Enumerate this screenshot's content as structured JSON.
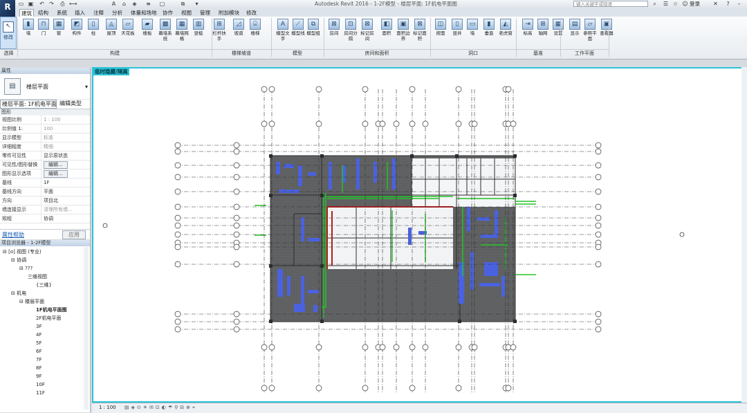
{
  "app": {
    "title": "Autodesk Revit 2016 -   1-2F模型 - 楼层平面: 1F机电平面图",
    "logo_letter": "R",
    "search_placeholder": "键入关键字或短语",
    "user_label": "登录"
  },
  "tabs": [
    "建筑",
    "结构",
    "系统",
    "插入",
    "注释",
    "分析",
    "体量和场地",
    "协作",
    "视图",
    "管理",
    "附加模块",
    "修改"
  ],
  "active_tab": "建筑",
  "ribbon": {
    "modify_label": "修改",
    "select_label": "选择",
    "buttons": [
      {
        "label": "墙",
        "icon": "wall-icon"
      },
      {
        "label": "门",
        "icon": "door-icon"
      },
      {
        "label": "窗",
        "icon": "window-icon"
      },
      {
        "label": "构件",
        "icon": "component-icon"
      },
      {
        "label": "柱",
        "icon": "column-icon"
      },
      {
        "label": "屋顶",
        "icon": "roof-icon"
      },
      {
        "label": "天花板",
        "icon": "ceiling-icon"
      },
      {
        "label": "楼板",
        "icon": "floor-icon"
      },
      {
        "label": "幕墙系统",
        "icon": "curtain-system-icon"
      },
      {
        "label": "幕墙网格",
        "icon": "curtain-grid-icon"
      },
      {
        "label": "竖梃",
        "icon": "mullion-icon"
      },
      {
        "label": "栏杆扶手",
        "icon": "railing-icon"
      },
      {
        "label": "坡道",
        "icon": "ramp-icon"
      },
      {
        "label": "楼梯",
        "icon": "stair-icon"
      },
      {
        "label": "模型文字",
        "icon": "model-text-icon"
      },
      {
        "label": "模型线",
        "icon": "model-line-icon"
      },
      {
        "label": "模型组",
        "icon": "model-group-icon"
      },
      {
        "label": "房间",
        "icon": "room-icon"
      },
      {
        "label": "房间分隔",
        "icon": "room-separator-icon"
      },
      {
        "label": "标记房间",
        "icon": "tag-room-icon"
      },
      {
        "label": "面积",
        "icon": "area-icon"
      },
      {
        "label": "面积边界",
        "icon": "area-boundary-icon"
      },
      {
        "label": "标记面积",
        "icon": "tag-area-icon"
      },
      {
        "label": "按面",
        "icon": "by-face-icon"
      },
      {
        "label": "竖井",
        "icon": "shaft-icon"
      },
      {
        "label": "墙",
        "icon": "wall-opening-icon"
      },
      {
        "label": "垂直",
        "icon": "vertical-icon"
      },
      {
        "label": "老虎窗",
        "icon": "dormer-icon"
      },
      {
        "label": "标高",
        "icon": "level-icon"
      },
      {
        "label": "轴网",
        "icon": "grid-icon"
      },
      {
        "label": "设置",
        "icon": "set-icon"
      },
      {
        "label": "显示",
        "icon": "show-icon"
      },
      {
        "label": "参照平面",
        "icon": "ref-plane-icon"
      },
      {
        "label": "查看器",
        "icon": "viewer-icon"
      }
    ],
    "groups": [
      "选择",
      "构建",
      "楼梯坡道",
      "模型",
      "房间和面积",
      "洞口",
      "基准",
      "工作平面"
    ]
  },
  "properties": {
    "header": "属性",
    "type_name": "楼层平面",
    "view_selector": "楼层平面: 1F机电平面图",
    "edit_type": "编辑类型",
    "section_graphics": "图形",
    "rows": [
      {
        "k": "视图比例",
        "v": "1 : 100",
        "dim": true
      },
      {
        "k": "比例值 1:",
        "v": "100",
        "dim": true
      },
      {
        "k": "显示模型",
        "v": "标准",
        "dim": true
      },
      {
        "k": "详细程度",
        "v": "精细",
        "dim": true
      },
      {
        "k": "零件可见性",
        "v": "显示原状态",
        "dim": false
      },
      {
        "k": "可见性/图形替换",
        "v": "编辑...",
        "dim": false,
        "btn": true
      },
      {
        "k": "图形显示选项",
        "v": "编辑...",
        "dim": false,
        "btn": true
      },
      {
        "k": "基线",
        "v": "1F",
        "dim": false
      },
      {
        "k": "基线方向",
        "v": "平面",
        "dim": false
      },
      {
        "k": "方向",
        "v": "项目北",
        "dim": false
      },
      {
        "k": "墙连接显示",
        "v": "清理所有墙...",
        "dim": true
      },
      {
        "k": "规程",
        "v": "协调",
        "dim": false
      }
    ],
    "help_link": "属性帮助",
    "apply": "应用"
  },
  "browser": {
    "header": "项目浏览器 - 1-2F模型",
    "nodes": [
      {
        "t": "[o] 视图 (专业)",
        "lvl": 0
      },
      {
        "t": "协调",
        "lvl": 1
      },
      {
        "t": "???",
        "lvl": 2
      },
      {
        "t": "三维视图",
        "lvl": 3
      },
      {
        "t": "{三维}",
        "lvl": 4
      },
      {
        "t": "机电",
        "lvl": 1
      },
      {
        "t": "楼层平面",
        "lvl": 2
      },
      {
        "t": "1F机电平面图",
        "lvl": 4,
        "bold": true
      },
      {
        "t": "2F机电平面",
        "lvl": 4
      },
      {
        "t": "3F",
        "lvl": 4
      },
      {
        "t": "4F",
        "lvl": 4
      },
      {
        "t": "5F",
        "lvl": 4
      },
      {
        "t": "6F",
        "lvl": 4
      },
      {
        "t": "7F",
        "lvl": 4
      },
      {
        "t": "8F",
        "lvl": 4
      },
      {
        "t": "9F",
        "lvl": 4
      },
      {
        "t": "10F",
        "lvl": 4
      },
      {
        "t": "11F",
        "lvl": 4
      }
    ]
  },
  "canvas": {
    "view_tag": "临时隐藏/隔离",
    "colors": {
      "border": "#2bc3d6",
      "slab": "#5f6062",
      "duct": "#4a62e0",
      "pipe": "#23c426",
      "wall": "#b51c1c"
    }
  },
  "statusbar": {
    "scale": "1 : 100"
  }
}
